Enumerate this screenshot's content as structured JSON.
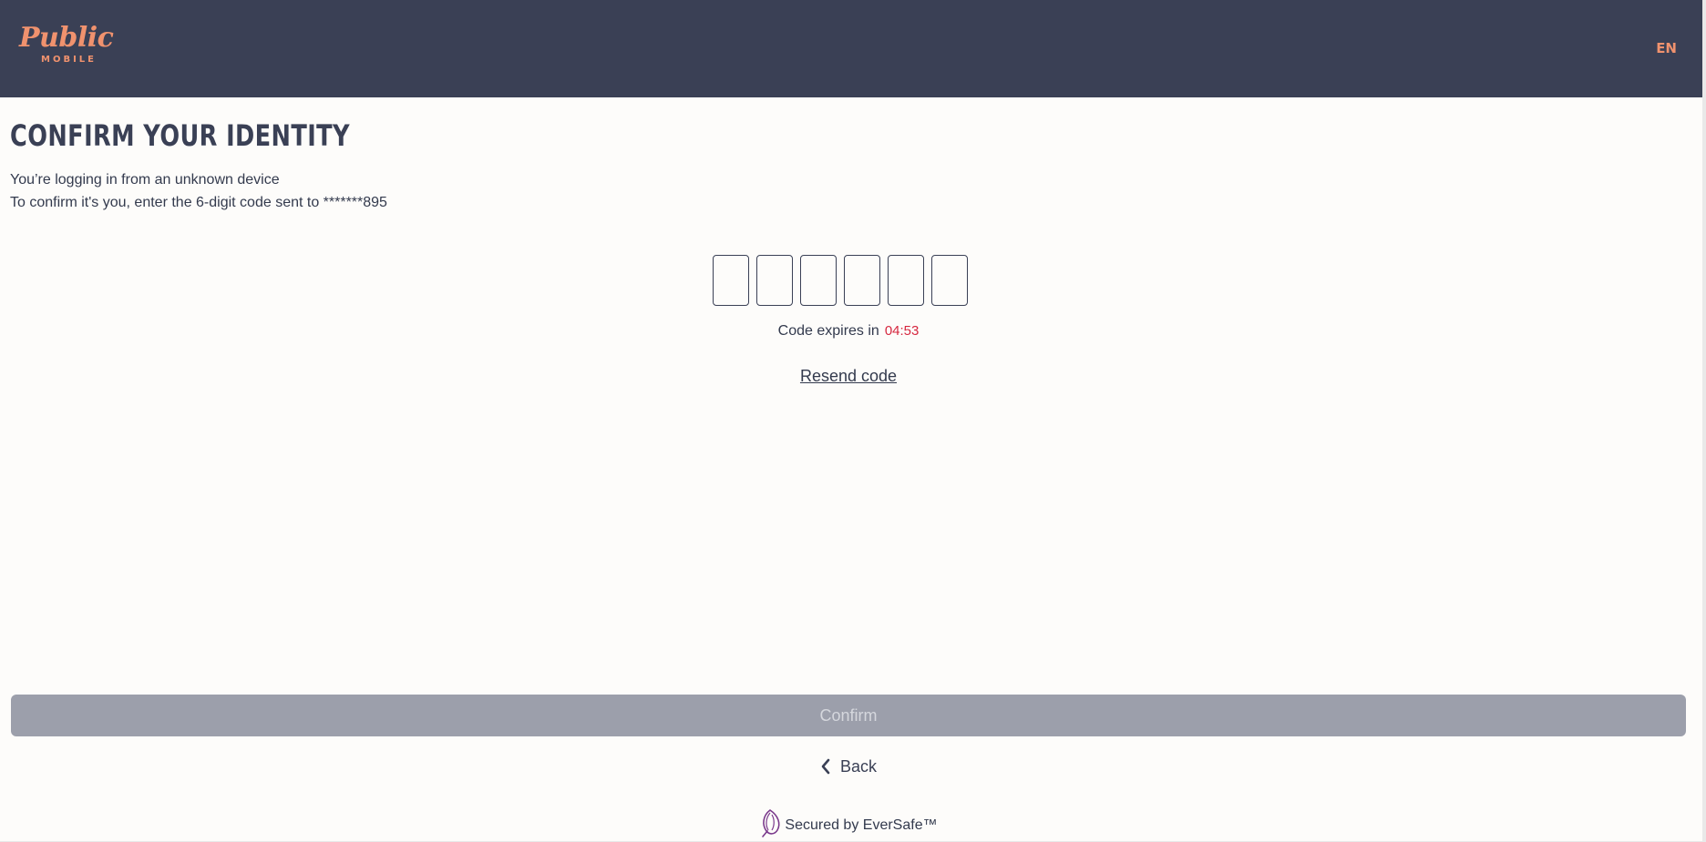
{
  "header": {
    "logo_main": "Public",
    "logo_sub": "MOBILE",
    "language": "EN"
  },
  "main": {
    "title": "CONFIRM YOUR IDENTITY",
    "line1": "You’re logging in from an unknown device",
    "line2": "To confirm it's you, enter the 6-digit code  sent to *******895",
    "code_digits": [
      "",
      "",
      "",
      "",
      "",
      ""
    ],
    "expires_label": "Code expires in",
    "expires_timer": "04:53",
    "resend_label": "Resend code"
  },
  "footer": {
    "confirm_label": "Confirm",
    "back_label": "Back",
    "secured_label": "Secured by EverSafe™"
  },
  "colors": {
    "header_bg": "#3a4055",
    "brand_accent": "#f0926e",
    "timer_red": "#d6273f",
    "disabled_button": "#9c9fab"
  },
  "icons": [
    "chevron-left-icon",
    "eversafe-leaf-icon"
  ]
}
